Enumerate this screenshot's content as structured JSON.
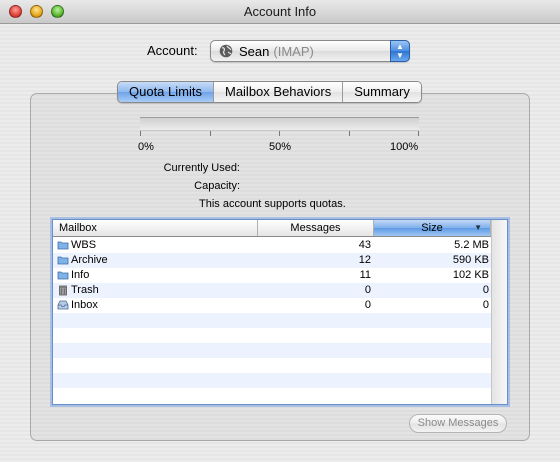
{
  "window": {
    "title": "Account Info"
  },
  "account": {
    "label": "Account:",
    "name": "Sean",
    "protocol": "(IMAP)"
  },
  "tabs": [
    {
      "label": "Quota Limits",
      "active": true
    },
    {
      "label": "Mailbox Behaviors",
      "active": false
    },
    {
      "label": "Summary",
      "active": false
    }
  ],
  "quota": {
    "used_fraction": 0,
    "ticks": [
      "0%",
      "50%",
      "100%"
    ],
    "currently_used_label": "Currently Used:",
    "capacity_label": "Capacity:",
    "support_text": "This account supports quotas."
  },
  "table": {
    "columns": [
      "Mailbox",
      "Messages",
      "Size"
    ],
    "sorted_by": "Size",
    "rows": [
      {
        "icon": "folder-icon",
        "name": "WBS",
        "messages": "43",
        "size": "5.2 MB"
      },
      {
        "icon": "folder-icon",
        "name": "Archive",
        "messages": "12",
        "size": "590 KB"
      },
      {
        "icon": "folder-icon",
        "name": "Info",
        "messages": "11",
        "size": "102 KB"
      },
      {
        "icon": "trash-icon",
        "name": "Trash",
        "messages": "0",
        "size": "0"
      },
      {
        "icon": "inbox-icon",
        "name": "Inbox",
        "messages": "0",
        "size": "0"
      }
    ]
  },
  "buttons": {
    "show_messages": "Show Messages"
  },
  "colors": {
    "accent": "#6ea3e8",
    "row_alt": "#edf3fe"
  }
}
